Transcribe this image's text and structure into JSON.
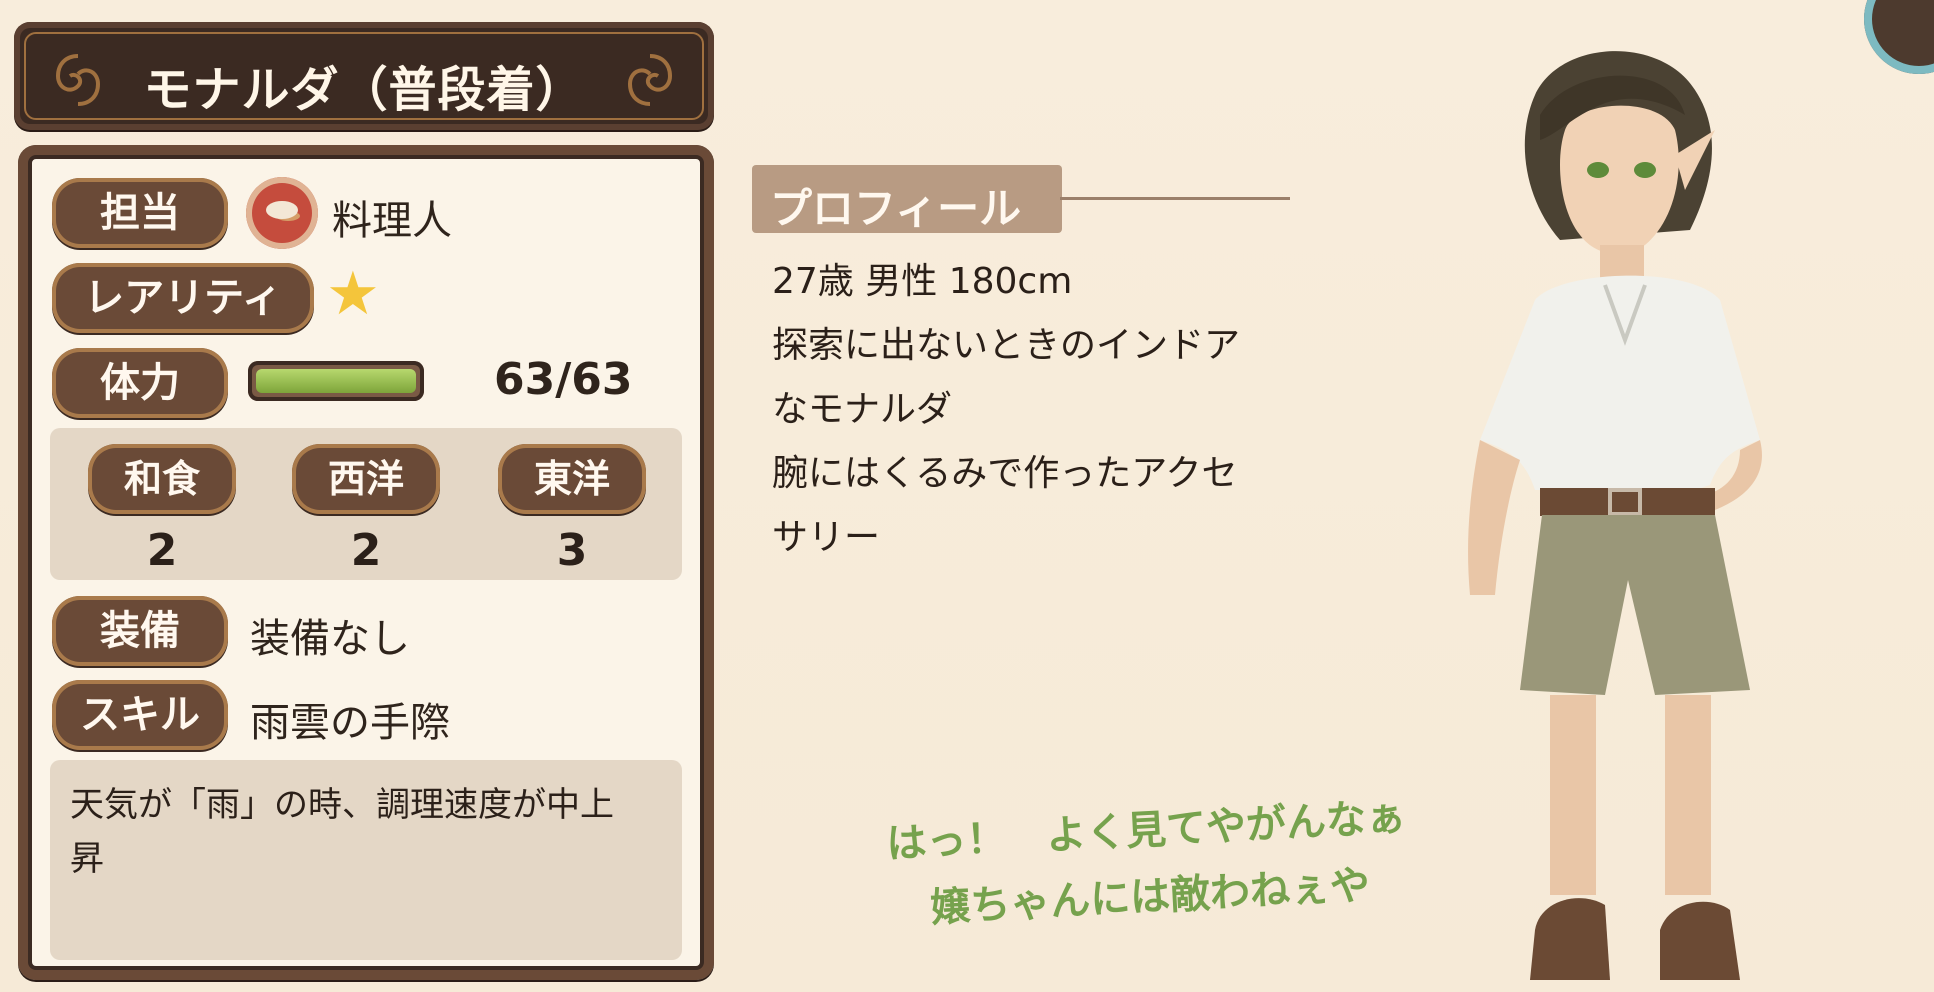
{
  "title": "モナルダ（普段着）",
  "labels": {
    "role": "担当",
    "rarity": "レアリティ",
    "hp": "体力",
    "equipment": "装備",
    "skill": "スキル"
  },
  "role": {
    "value": "料理人",
    "icon": "frying-pan-icon"
  },
  "rarity": {
    "stars": 1,
    "icon": "star-icon"
  },
  "hp": {
    "current": 63,
    "max": 63,
    "text": "63/63",
    "fill_fraction": 1.0
  },
  "cuisines": [
    {
      "label": "和食",
      "value": "2"
    },
    {
      "label": "西洋",
      "value": "2"
    },
    {
      "label": "東洋",
      "value": "3"
    }
  ],
  "equipment_value": "装備なし",
  "skill": {
    "name": "雨雲の手際",
    "description": "天気が「雨」の時、調理速度が中上\n昇"
  },
  "profile": {
    "heading": "プロフィール",
    "lines": [
      "27歳 男性 180cm",
      "探索に出ないときのインドア",
      "なモナルダ",
      "腕にはくるみで作ったアクセ",
      "サリー"
    ]
  },
  "quote": {
    "line1": "はっ！　よく見てやがんなぁ",
    "line2": "嬢ちゃんには敵わねぇや"
  },
  "colors": {
    "background": "#f7ecdb",
    "banner": "#3b2a22",
    "badge": "#6a4a37",
    "quote": "#76a24d",
    "hp_bar": "#7ea53a"
  }
}
